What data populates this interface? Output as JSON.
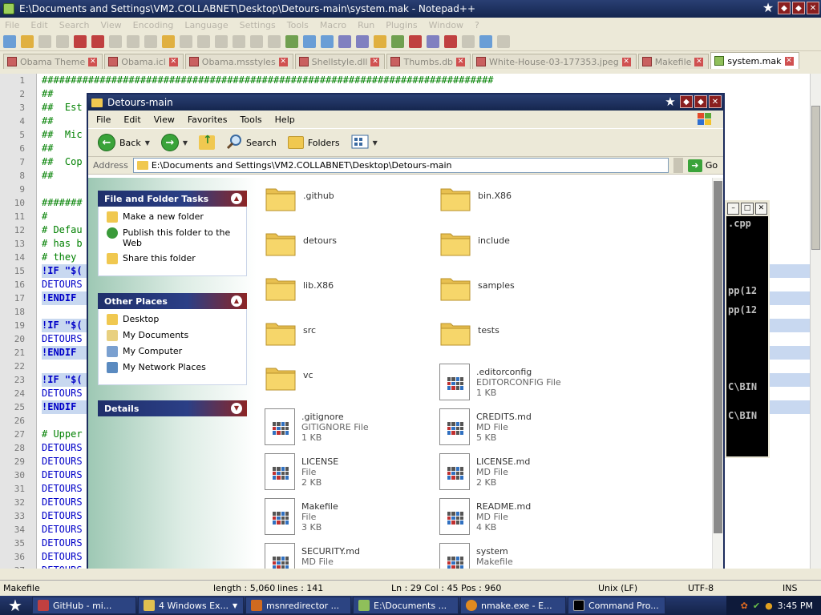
{
  "npp": {
    "title": "E:\\Documents and Settings\\VM2.COLLABNET\\Desktop\\Detours-main\\system.mak - Notepad++",
    "menu": [
      "File",
      "Edit",
      "Search",
      "View",
      "Encoding",
      "Language",
      "Settings",
      "Tools",
      "Macro",
      "Run",
      "Plugins",
      "Window",
      "?"
    ],
    "tabs": [
      "Obama Theme",
      "Obama.icl",
      "Obama.msstyles",
      "Shellstyle.dll",
      "Thumbs.db",
      "White-House-03-177353.jpeg",
      "Makefile",
      "system.mak"
    ],
    "line_numbers": [
      "1",
      "2",
      "3",
      "4",
      "5",
      "6",
      "7",
      "8",
      "9",
      "10",
      "11",
      "12",
      "13",
      "14",
      "15",
      "16",
      "17",
      "18",
      "19",
      "20",
      "21",
      "22",
      "23",
      "24",
      "25",
      "26",
      "27",
      "28",
      "29",
      "30",
      "31",
      "32",
      "33",
      "34",
      "35",
      "36",
      "37"
    ],
    "code_lines": [
      "##############################################################################",
      "##",
      "##  Est",
      "##",
      "##  Mic",
      "##",
      "##  Cop",
      "##",
      "",
      "#######",
      "#",
      "# Defau",
      "# has b",
      "# they",
      "!IF \"$(",
      "DETOURS",
      "!ENDIF",
      "",
      "!IF \"$(",
      "DETOURS",
      "!ENDIF",
      "",
      "!IF \"$(",
      "DETOURS",
      "!ENDIF",
      "",
      "# Upper",
      "DETOURS",
      "DETOURS",
      "DETOURS",
      "DETOURS",
      "DETOURS",
      "DETOURS",
      "DETOURS",
      "DETOURS",
      "DETOURS",
      "DETOURS_TARGET_PROCESSOR=$(DETOURS_TARGET_PROCESSOR:i=I)"
    ],
    "status": {
      "file_type": "Makefile",
      "length": "length : 5,060",
      "lines": "lines : 141",
      "pos": "Ln : 29    Col : 45    Pos : 960",
      "eol": "Unix (LF)",
      "encoding": "UTF-8",
      "mode": "INS"
    }
  },
  "cmd": {
    "lines": [
      ".cpp",
      "pp(12",
      "pp(12",
      "C\\BIN",
      "C\\BIN"
    ]
  },
  "explorer": {
    "title": "Detours-main",
    "menu": [
      "File",
      "Edit",
      "View",
      "Favorites",
      "Tools",
      "Help"
    ],
    "toolbar": {
      "back": "Back",
      "search": "Search",
      "folders": "Folders"
    },
    "address_label": "Address",
    "address_value": "E:\\Documents and Settings\\VM2.COLLABNET\\Desktop\\Detours-main",
    "go_label": "Go",
    "file_tasks": {
      "header": "File and Folder Tasks",
      "items": [
        "Make a new folder",
        "Publish this folder to the Web",
        "Share this folder"
      ]
    },
    "other_places": {
      "header": "Other Places",
      "items": [
        "Desktop",
        "My Documents",
        "My Computer",
        "My Network Places"
      ]
    },
    "details": {
      "header": "Details"
    },
    "items": [
      {
        "name": ".github",
        "type": "",
        "size": "",
        "kind": "folder"
      },
      {
        "name": "bin.X86",
        "type": "",
        "size": "",
        "kind": "folder"
      },
      {
        "name": "detours",
        "type": "",
        "size": "",
        "kind": "folder"
      },
      {
        "name": "include",
        "type": "",
        "size": "",
        "kind": "folder"
      },
      {
        "name": "lib.X86",
        "type": "",
        "size": "",
        "kind": "folder"
      },
      {
        "name": "samples",
        "type": "",
        "size": "",
        "kind": "folder"
      },
      {
        "name": "src",
        "type": "",
        "size": "",
        "kind": "folder"
      },
      {
        "name": "tests",
        "type": "",
        "size": "",
        "kind": "folder"
      },
      {
        "name": "vc",
        "type": "",
        "size": "",
        "kind": "folder"
      },
      {
        "name": ".editorconfig",
        "type": "EDITORCONFIG File",
        "size": "1 KB",
        "kind": "file"
      },
      {
        "name": ".gitignore",
        "type": "GITIGNORE File",
        "size": "1 KB",
        "kind": "file"
      },
      {
        "name": "CREDITS.md",
        "type": "MD File",
        "size": "5 KB",
        "kind": "file"
      },
      {
        "name": "LICENSE",
        "type": "File",
        "size": "2 KB",
        "kind": "file"
      },
      {
        "name": "LICENSE.md",
        "type": "MD File",
        "size": "2 KB",
        "kind": "file"
      },
      {
        "name": "Makefile",
        "type": "File",
        "size": "3 KB",
        "kind": "file"
      },
      {
        "name": "README.md",
        "type": "MD File",
        "size": "4 KB",
        "kind": "file"
      },
      {
        "name": "SECURITY.md",
        "type": "MD File",
        "size": "",
        "kind": "file"
      },
      {
        "name": "system",
        "type": "Makefile",
        "size": "",
        "kind": "file"
      }
    ]
  },
  "taskbar": {
    "buttons": [
      "GitHub - mi...",
      "4 Windows Ex...",
      "msnredirector ...",
      "E:\\Documents ...",
      "nmake.exe - E...",
      "Command Pro..."
    ],
    "clock": "3:45 PM"
  }
}
